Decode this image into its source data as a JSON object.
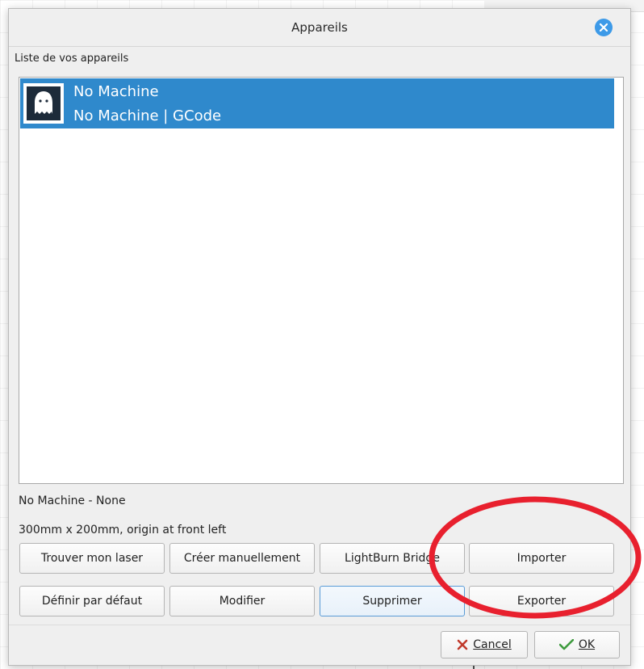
{
  "dialog": {
    "title": "Appareils",
    "list_label": "Liste de vos appareils"
  },
  "devices": [
    {
      "name": "No Machine",
      "subtitle": "No Machine | GCode",
      "icon": "ghost-icon",
      "selected": true
    }
  ],
  "details": {
    "line1": "No Machine - None",
    "line2": "300mm x 200mm, origin at front left"
  },
  "buttons": {
    "find_laser": "Trouver mon laser",
    "create_manually": "Créer manuellement",
    "lightburn_bridge": "LightBurn Bridge",
    "import": "Importer",
    "set_default": "Définir par défaut",
    "modify": "Modifier",
    "delete": "Supprimer",
    "export": "Exporter",
    "cancel": "Cancel",
    "ok": "OK"
  },
  "colors": {
    "selection": "#2f89cc",
    "close_button": "#3d9ae8",
    "annotation": "#e8202e"
  }
}
